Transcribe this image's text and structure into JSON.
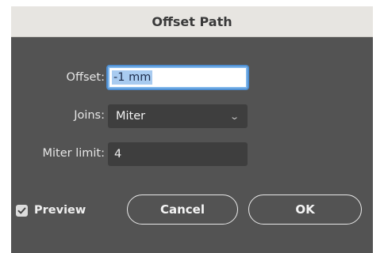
{
  "dialog": {
    "title": "Offset Path"
  },
  "fields": {
    "offset": {
      "label": "Offset:",
      "value": "-1 mm"
    },
    "joins": {
      "label": "Joins:",
      "value": "Miter",
      "icon": "chevron-down-icon"
    },
    "miter_limit": {
      "label": "Miter limit:",
      "value": "4"
    }
  },
  "preview": {
    "label": "Preview",
    "checked": true
  },
  "buttons": {
    "cancel": "Cancel",
    "ok": "OK"
  },
  "colors": {
    "dialog_bg": "#535353",
    "titlebar_bg": "#e7e5e1",
    "field_bg": "#3e3e3e",
    "focus_ring": "#4e8fd3",
    "selection": "#a8cbf0"
  }
}
